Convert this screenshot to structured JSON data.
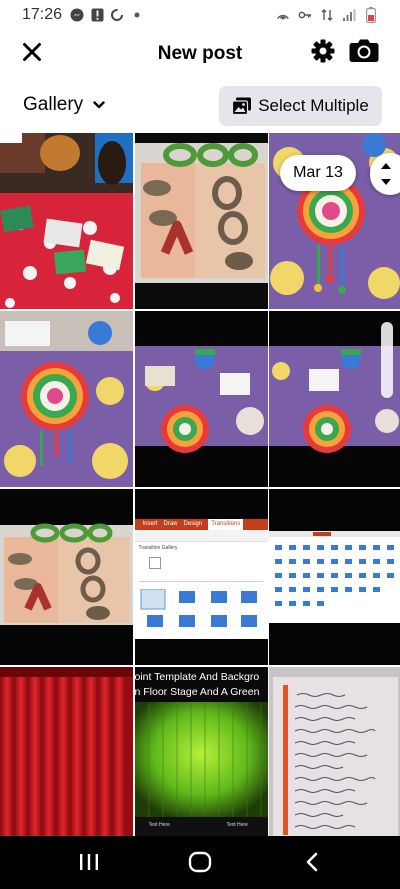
{
  "status_bar": {
    "time": "17:26",
    "left_icons": [
      "messenger-icon",
      "alert-icon",
      "sync-icon",
      "dot-icon"
    ],
    "right_icons": [
      "hotspot-icon",
      "key-icon",
      "data-icon",
      "signal-icon",
      "battery-icon"
    ]
  },
  "header": {
    "title": "New post",
    "close_icon": "close-icon",
    "settings_icon": "gear-icon",
    "camera_icon": "camera-icon"
  },
  "toolbar": {
    "gallery_label": "Gallery",
    "select_multiple_label": "Select Multiple"
  },
  "scrubber": {
    "date_label": "Mar 13"
  },
  "grid": {
    "tiles": [
      {
        "name": "classroom-photo"
      },
      {
        "name": "clay-letters-photo"
      },
      {
        "name": "craft-tablecloth-photo"
      },
      {
        "name": "craft-tablecloth-photo-2"
      },
      {
        "name": "craft-tablecloth-photo-3"
      },
      {
        "name": "craft-tablecloth-photo-4"
      },
      {
        "name": "clay-letters-photo-2"
      },
      {
        "name": "powerpoint-transitions-screenshot",
        "tab_labels": [
          "Insert",
          "Draw",
          "Design",
          "Transitions"
        ],
        "panel_title": "Transition Gallery"
      },
      {
        "name": "ribbon-screenshot"
      },
      {
        "name": "red-curtain-image"
      },
      {
        "name": "green-stage-image",
        "caption": "oint Template And Backgro",
        "caption2": "n Floor Stage And A Green",
        "footer_left": "Text Here",
        "footer_right": "Text Here"
      },
      {
        "name": "handwritten-notes-photo"
      }
    ]
  },
  "nav_bar": {
    "recents_icon": "recents-icon",
    "home_icon": "home-icon",
    "back_icon": "back-icon"
  },
  "colors": {
    "accent": "#050505",
    "button_bg": "#e4e6eb",
    "curtain_red": "#c8161c",
    "stage_green": "#6fcf1a"
  }
}
